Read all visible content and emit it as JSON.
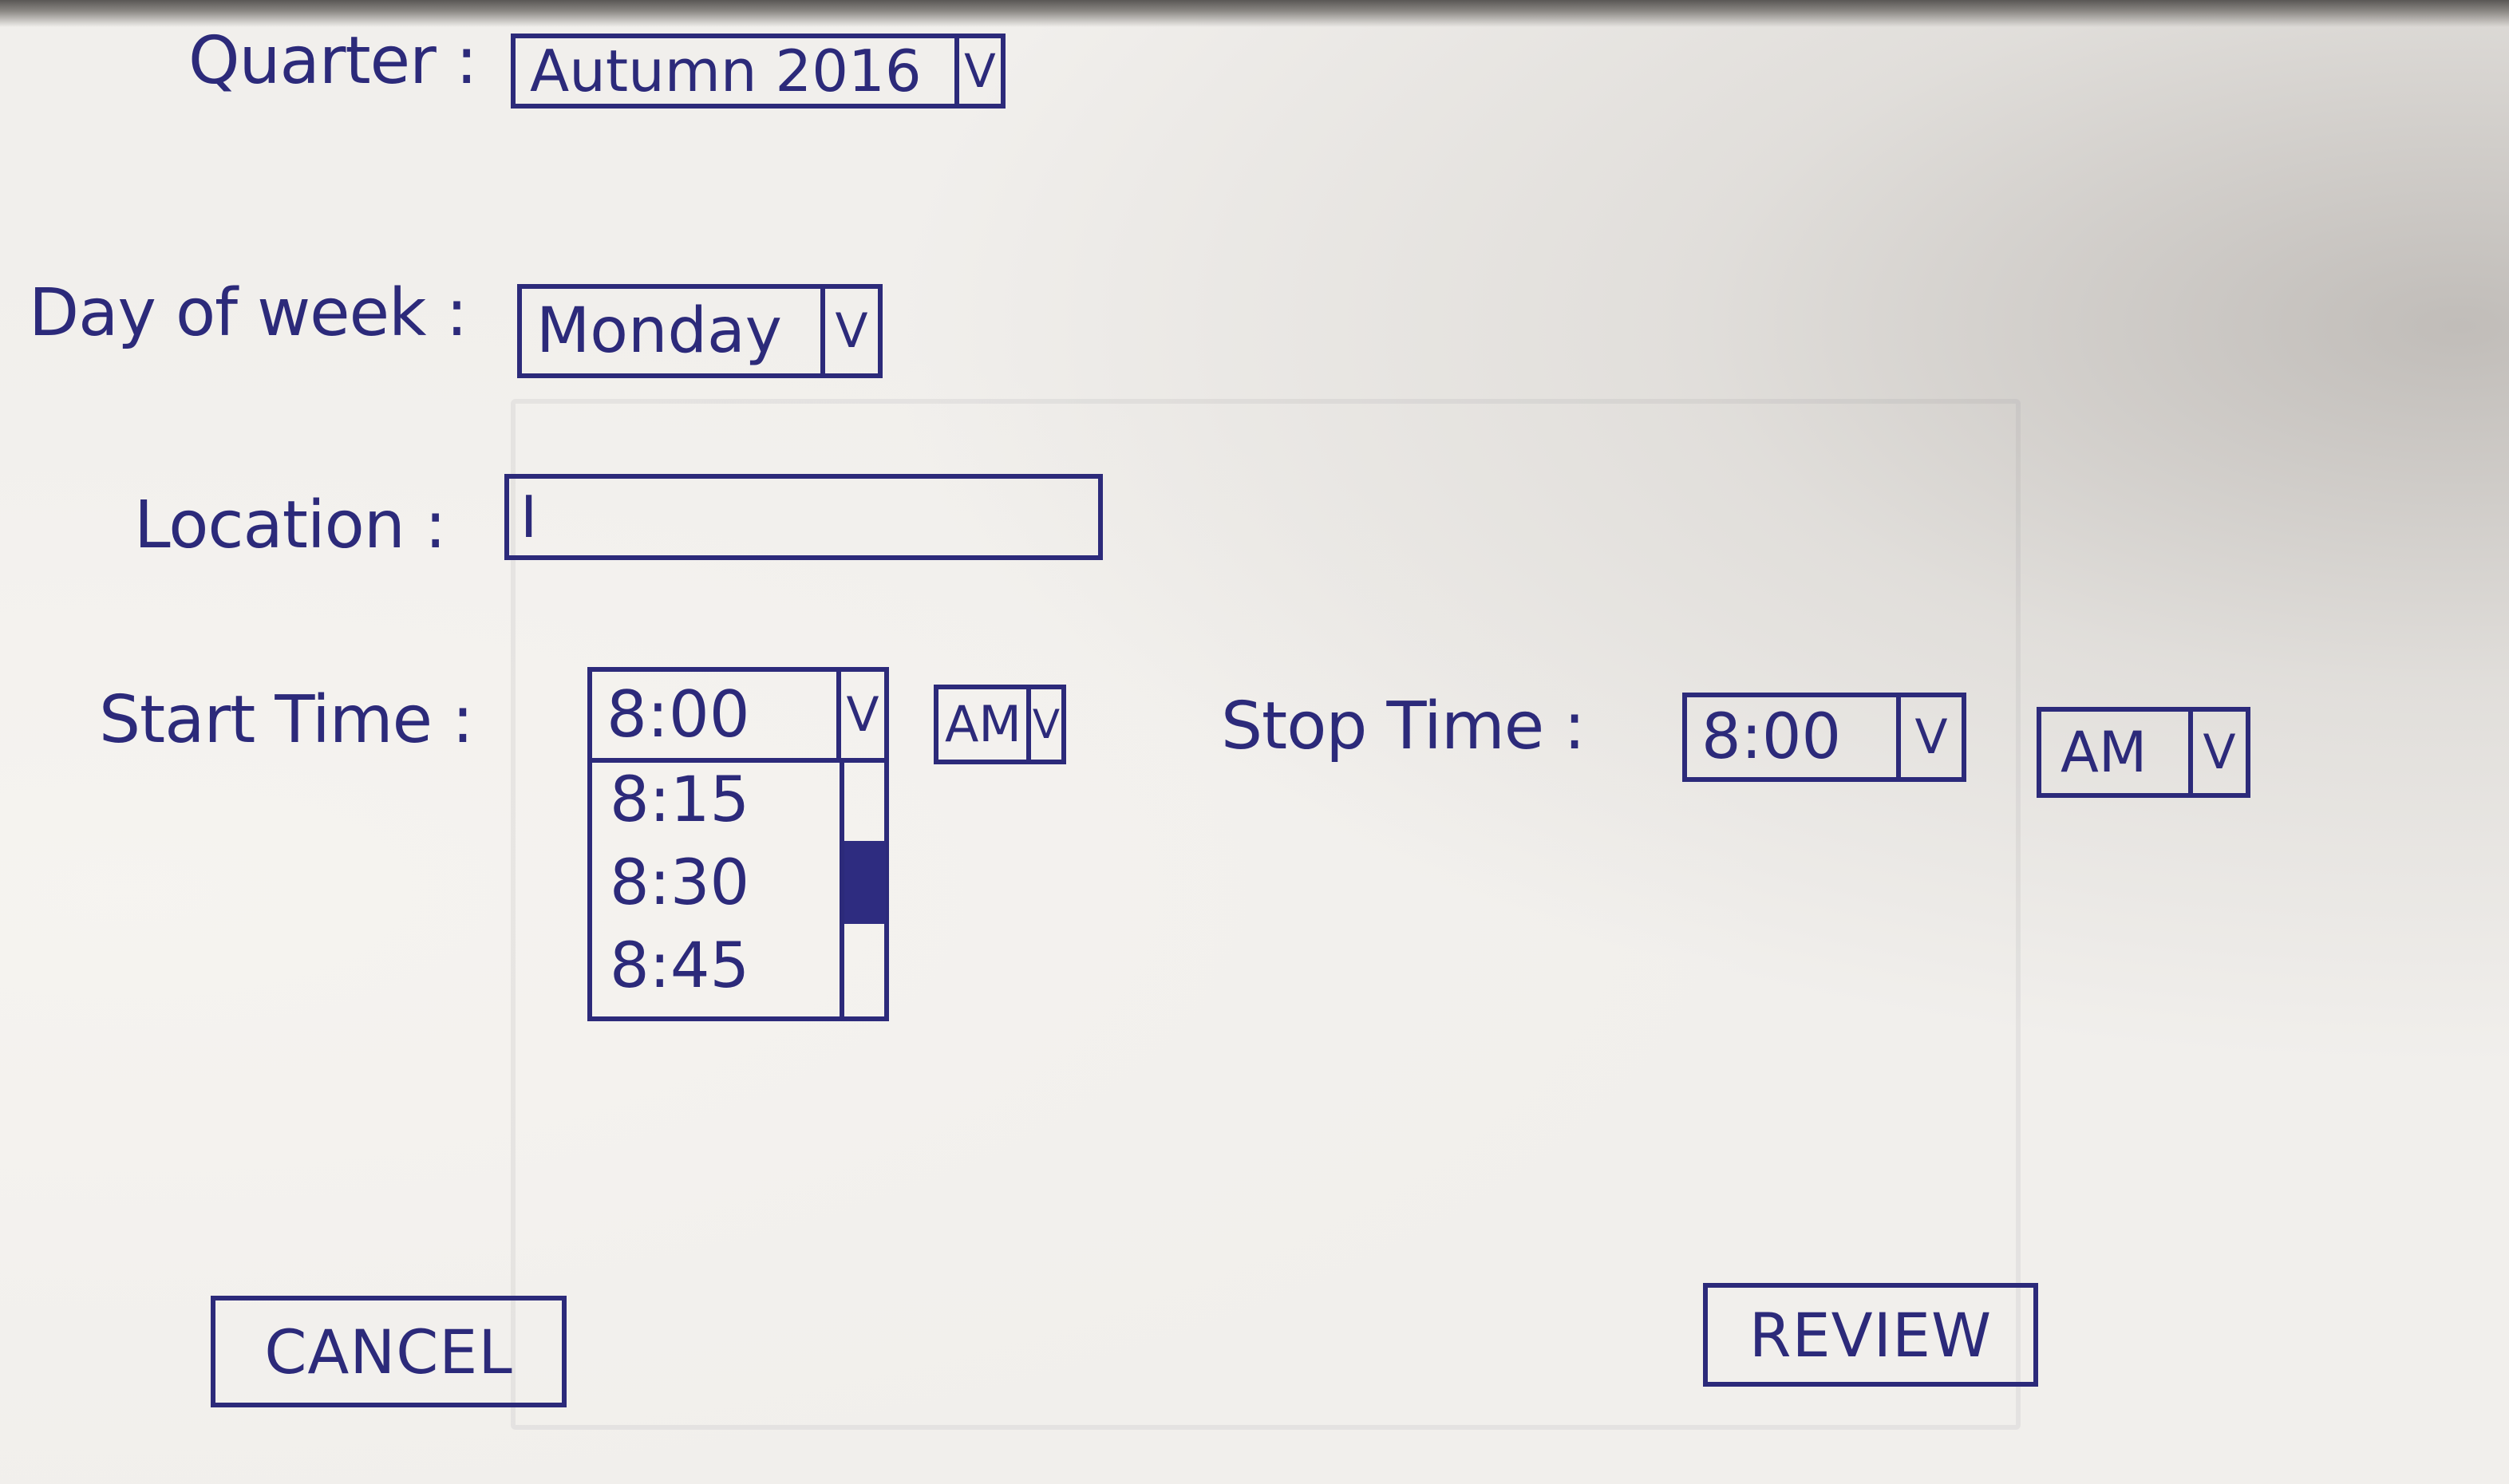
{
  "form": {
    "quarter": {
      "label": "Quarter :",
      "value": "Autumn 2016",
      "dropdown_glyph": "V"
    },
    "day_of_week": {
      "label": "Day of week :",
      "value": "Monday",
      "dropdown_glyph": "V"
    },
    "location": {
      "label": "Location :",
      "value": "",
      "cursor_glyph": "I"
    },
    "start_time": {
      "label": "Start Time :",
      "value": "8:00",
      "dropdown_glyph": "V",
      "options": [
        "8:15",
        "8:30",
        "8:45"
      ],
      "ampm": "AM",
      "ampm_glyph": "V"
    },
    "stop_time": {
      "label": "Stop Time :",
      "value": "8:00",
      "dropdown_glyph": "V",
      "ampm": "AM",
      "ampm_glyph": "V"
    }
  },
  "buttons": {
    "cancel": "CANCEL",
    "review": "REVIEW"
  },
  "colors": {
    "ink": "#2c2a7a",
    "paper": "#f1efec"
  }
}
